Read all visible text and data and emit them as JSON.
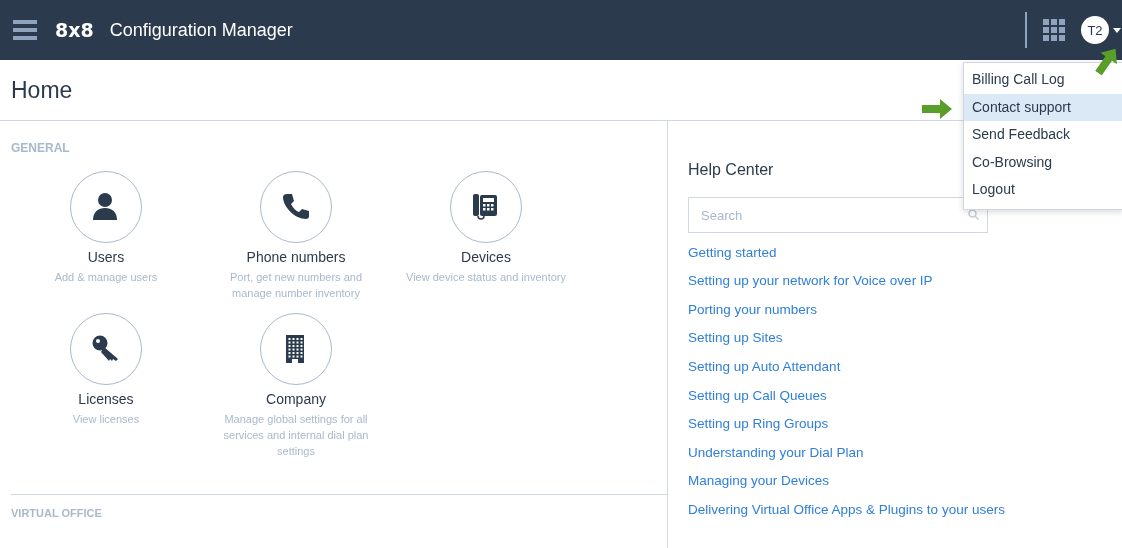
{
  "header": {
    "logo": "8x8",
    "title": "Configuration Manager",
    "avatar": "T2"
  },
  "user_menu": {
    "expanded": true,
    "items": [
      {
        "label": "Billing Call Log",
        "selected": false
      },
      {
        "label": "Contact support",
        "selected": true
      },
      {
        "label": "Send Feedback",
        "selected": false
      },
      {
        "label": "Co-Browsing",
        "selected": false
      },
      {
        "label": "Logout",
        "selected": false
      }
    ]
  },
  "page_title": "Home",
  "sections": [
    {
      "heading": "GENERAL",
      "tiles": [
        {
          "kind": "user",
          "title": "Users",
          "description": "Add & manage users"
        },
        {
          "kind": "phone",
          "title": "Phone numbers",
          "description": "Port, get new numbers and manage number inventory"
        },
        {
          "kind": "deskphone",
          "title": "Devices",
          "description": "View device status and inventory"
        },
        {
          "kind": "key",
          "title": "Licenses",
          "description": "View licenses"
        },
        {
          "kind": "building",
          "title": "Company",
          "description": "Manage global settings for all services and internal dial plan settings"
        }
      ]
    },
    {
      "heading": "VIRTUAL OFFICE"
    }
  ],
  "help": {
    "title": "Help Center",
    "search": {
      "placeholder": "Search"
    },
    "links": [
      "Getting started",
      "Setting up your network for Voice over IP",
      "Porting your numbers",
      "Setting up Sites",
      "Setting up Auto Attendant",
      "Setting up Call Queues",
      "Setting up Ring Groups",
      "Understanding your Dial Plan",
      "Managing your Devices",
      "Delivering Virtual Office Apps & Plugins to your users"
    ]
  }
}
